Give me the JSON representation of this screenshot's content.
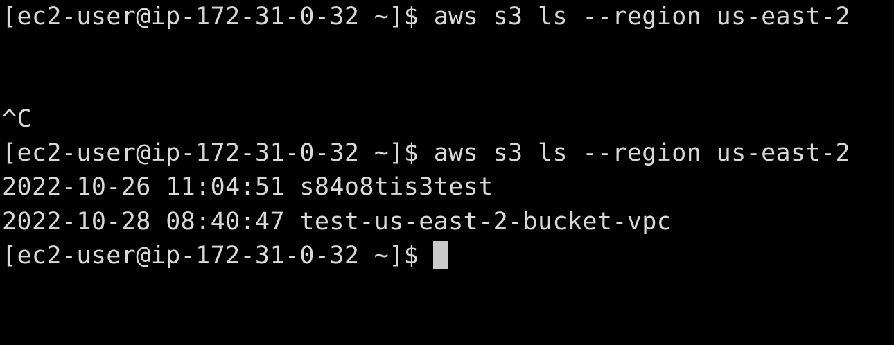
{
  "terminal": {
    "prompt": "[ec2-user@ip-172-31-0-32 ~]$",
    "lines": [
      {
        "prompt": "[ec2-user@ip-172-31-0-32 ~]$",
        "command": "aws s3 ls --region us-east-2"
      },
      {
        "text": "^C"
      },
      {
        "prompt": "[ec2-user@ip-172-31-0-32 ~]$",
        "command": "aws s3 ls --region us-east-2"
      },
      {
        "text": "2022-10-26 11:04:51 s84o8tis3test"
      },
      {
        "text": "2022-10-28 08:40:47 test-us-east-2-bucket-vpc"
      },
      {
        "prompt": "[ec2-user@ip-172-31-0-32 ~]$",
        "command": ""
      }
    ],
    "colors": {
      "background": "#000000",
      "text": "#d8d8d8",
      "cursor": "#c9c9c9"
    }
  }
}
